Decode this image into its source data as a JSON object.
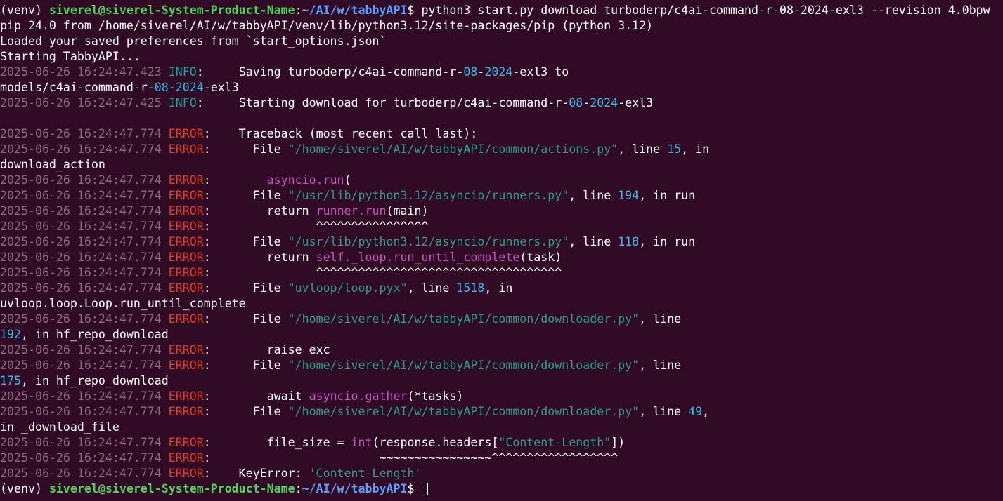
{
  "colors": {
    "background": "#300a24",
    "default": "#ffffff",
    "timestamp": "#8a6a82",
    "info": "#1fa39a",
    "error": "#e03b2c",
    "number": "#3bb8e6",
    "string": "#2a9d8f",
    "func": "#c855c8",
    "prompt_user": "#4fd45a",
    "prompt_path": "#5aa0ff"
  },
  "terminal": {
    "lines": [
      {
        "segs": [
          [
            "default",
            "(venv) "
          ],
          [
            "prompt_user",
            "siverel@siverel-System-Product-Name"
          ],
          [
            "default",
            ":"
          ],
          [
            "prompt_path",
            "~/AI/w/tabbyAPI"
          ],
          [
            "default",
            "$ python3 start.py download turboderp/c4ai-command-r-08-2024-exl3 --revision 4.0bpw"
          ]
        ]
      },
      {
        "segs": [
          [
            "default",
            "pip 24.0 from /home/siverel/AI/w/tabbyAPI/venv/lib/python3.12/site-packages/pip (python 3.12)"
          ]
        ]
      },
      {
        "segs": [
          [
            "default",
            "Loaded your saved preferences from `start_options.json`"
          ]
        ]
      },
      {
        "segs": [
          [
            "default",
            "Starting TabbyAPI..."
          ]
        ]
      },
      {
        "segs": [
          [
            "timestamp",
            "2025-06-26 16:24:47.423 "
          ],
          [
            "info",
            "INFO"
          ],
          [
            "default",
            ":     Saving turboderp/c4ai-command-r-"
          ],
          [
            "number",
            "08"
          ],
          [
            "default",
            "-"
          ],
          [
            "number",
            "2024"
          ],
          [
            "default",
            "-exl3 to"
          ]
        ]
      },
      {
        "segs": [
          [
            "default",
            "models/c4ai-command-r-"
          ],
          [
            "number",
            "08"
          ],
          [
            "default",
            "-"
          ],
          [
            "number",
            "2024"
          ],
          [
            "default",
            "-exl3"
          ]
        ]
      },
      {
        "segs": [
          [
            "timestamp",
            "2025-06-26 16:24:47.425 "
          ],
          [
            "info",
            "INFO"
          ],
          [
            "default",
            ":     Starting download for turboderp/c4ai-command-r-"
          ],
          [
            "number",
            "08"
          ],
          [
            "default",
            "-"
          ],
          [
            "number",
            "2024"
          ],
          [
            "default",
            "-exl3"
          ]
        ]
      },
      {
        "segs": [
          [
            "default",
            ""
          ]
        ]
      },
      {
        "segs": [
          [
            "timestamp",
            "2025-06-26 16:24:47.774 "
          ],
          [
            "error",
            "ERROR"
          ],
          [
            "default",
            ":    Traceback (most recent call last):"
          ]
        ]
      },
      {
        "segs": [
          [
            "timestamp",
            "2025-06-26 16:24:47.774 "
          ],
          [
            "error",
            "ERROR"
          ],
          [
            "default",
            ":      File "
          ],
          [
            "string",
            "\"/home/siverel/AI/w/tabbyAPI/common/actions.py\""
          ],
          [
            "default",
            ", line "
          ],
          [
            "number",
            "15"
          ],
          [
            "default",
            ", in"
          ]
        ]
      },
      {
        "segs": [
          [
            "default",
            "download_action"
          ]
        ]
      },
      {
        "segs": [
          [
            "timestamp",
            "2025-06-26 16:24:47.774 "
          ],
          [
            "error",
            "ERROR"
          ],
          [
            "default",
            ":        "
          ],
          [
            "func",
            "asyncio.run"
          ],
          [
            "default",
            "("
          ]
        ]
      },
      {
        "segs": [
          [
            "timestamp",
            "2025-06-26 16:24:47.774 "
          ],
          [
            "error",
            "ERROR"
          ],
          [
            "default",
            ":      File "
          ],
          [
            "string",
            "\"/usr/lib/python3.12/asyncio/runners.py\""
          ],
          [
            "default",
            ", line "
          ],
          [
            "number",
            "194"
          ],
          [
            "default",
            ", in run"
          ]
        ]
      },
      {
        "segs": [
          [
            "timestamp",
            "2025-06-26 16:24:47.774 "
          ],
          [
            "error",
            "ERROR"
          ],
          [
            "default",
            ":        return "
          ],
          [
            "func",
            "runner.run"
          ],
          [
            "default",
            "(main)"
          ]
        ]
      },
      {
        "segs": [
          [
            "timestamp",
            "2025-06-26 16:24:47.774 "
          ],
          [
            "error",
            "ERROR"
          ],
          [
            "default",
            ":               ^^^^^^^^^^^^^^^^"
          ]
        ]
      },
      {
        "segs": [
          [
            "timestamp",
            "2025-06-26 16:24:47.774 "
          ],
          [
            "error",
            "ERROR"
          ],
          [
            "default",
            ":      File "
          ],
          [
            "string",
            "\"/usr/lib/python3.12/asyncio/runners.py\""
          ],
          [
            "default",
            ", line "
          ],
          [
            "number",
            "118"
          ],
          [
            "default",
            ", in run"
          ]
        ]
      },
      {
        "segs": [
          [
            "timestamp",
            "2025-06-26 16:24:47.774 "
          ],
          [
            "error",
            "ERROR"
          ],
          [
            "default",
            ":        return "
          ],
          [
            "func",
            "self._loop.run_until_complete"
          ],
          [
            "default",
            "(task)"
          ]
        ]
      },
      {
        "segs": [
          [
            "timestamp",
            "2025-06-26 16:24:47.774 "
          ],
          [
            "error",
            "ERROR"
          ],
          [
            "default",
            ":               ^^^^^^^^^^^^^^^^^^^^^^^^^^^^^^^^^^^"
          ]
        ]
      },
      {
        "segs": [
          [
            "timestamp",
            "2025-06-26 16:24:47.774 "
          ],
          [
            "error",
            "ERROR"
          ],
          [
            "default",
            ":      File "
          ],
          [
            "string",
            "\"uvloop/loop.pyx\""
          ],
          [
            "default",
            ", line "
          ],
          [
            "number",
            "1518"
          ],
          [
            "default",
            ", in"
          ]
        ]
      },
      {
        "segs": [
          [
            "default",
            "uvloop.loop.Loop.run_until_complete"
          ]
        ]
      },
      {
        "segs": [
          [
            "timestamp",
            "2025-06-26 16:24:47.774 "
          ],
          [
            "error",
            "ERROR"
          ],
          [
            "default",
            ":      File "
          ],
          [
            "string",
            "\"/home/siverel/AI/w/tabbyAPI/common/downloader.py\""
          ],
          [
            "default",
            ", line"
          ]
        ]
      },
      {
        "segs": [
          [
            "number",
            "192"
          ],
          [
            "default",
            ", in hf_repo_download"
          ]
        ]
      },
      {
        "segs": [
          [
            "timestamp",
            "2025-06-26 16:24:47.774 "
          ],
          [
            "error",
            "ERROR"
          ],
          [
            "default",
            ":        raise exc"
          ]
        ]
      },
      {
        "segs": [
          [
            "timestamp",
            "2025-06-26 16:24:47.774 "
          ],
          [
            "error",
            "ERROR"
          ],
          [
            "default",
            ":      File "
          ],
          [
            "string",
            "\"/home/siverel/AI/w/tabbyAPI/common/downloader.py\""
          ],
          [
            "default",
            ", line"
          ]
        ]
      },
      {
        "segs": [
          [
            "number",
            "175"
          ],
          [
            "default",
            ", in hf_repo_download"
          ]
        ]
      },
      {
        "segs": [
          [
            "timestamp",
            "2025-06-26 16:24:47.774 "
          ],
          [
            "error",
            "ERROR"
          ],
          [
            "default",
            ":        await "
          ],
          [
            "func",
            "asyncio.gather"
          ],
          [
            "default",
            "(*tasks)"
          ]
        ]
      },
      {
        "segs": [
          [
            "timestamp",
            "2025-06-26 16:24:47.774 "
          ],
          [
            "error",
            "ERROR"
          ],
          [
            "default",
            ":      File "
          ],
          [
            "string",
            "\"/home/siverel/AI/w/tabbyAPI/common/downloader.py\""
          ],
          [
            "default",
            ", line "
          ],
          [
            "number",
            "49"
          ],
          [
            "default",
            ","
          ]
        ]
      },
      {
        "segs": [
          [
            "default",
            "in _download_file"
          ]
        ]
      },
      {
        "segs": [
          [
            "timestamp",
            "2025-06-26 16:24:47.774 "
          ],
          [
            "error",
            "ERROR"
          ],
          [
            "default",
            ":        file_size = "
          ],
          [
            "func",
            "int"
          ],
          [
            "default",
            "(response.headers["
          ],
          [
            "string",
            "\"Content-Length\""
          ],
          [
            "default",
            "])"
          ]
        ]
      },
      {
        "segs": [
          [
            "timestamp",
            "2025-06-26 16:24:47.774 "
          ],
          [
            "error",
            "ERROR"
          ],
          [
            "default",
            ":                        ~~~~~~~~~~~~~~~~^^^^^^^^^^^^^^^^^^"
          ]
        ]
      },
      {
        "segs": [
          [
            "timestamp",
            "2025-06-26 16:24:47.774 "
          ],
          [
            "error",
            "ERROR"
          ],
          [
            "default",
            ":    KeyError: "
          ],
          [
            "string",
            "'Content-Length'"
          ]
        ]
      },
      {
        "segs": [
          [
            "default",
            "(venv) "
          ],
          [
            "prompt_user",
            "siverel@siverel-System-Product-Name"
          ],
          [
            "default",
            ":"
          ],
          [
            "prompt_path",
            "~/AI/w/tabbyAPI"
          ],
          [
            "default",
            "$ "
          ]
        ],
        "cursor": true
      }
    ]
  }
}
